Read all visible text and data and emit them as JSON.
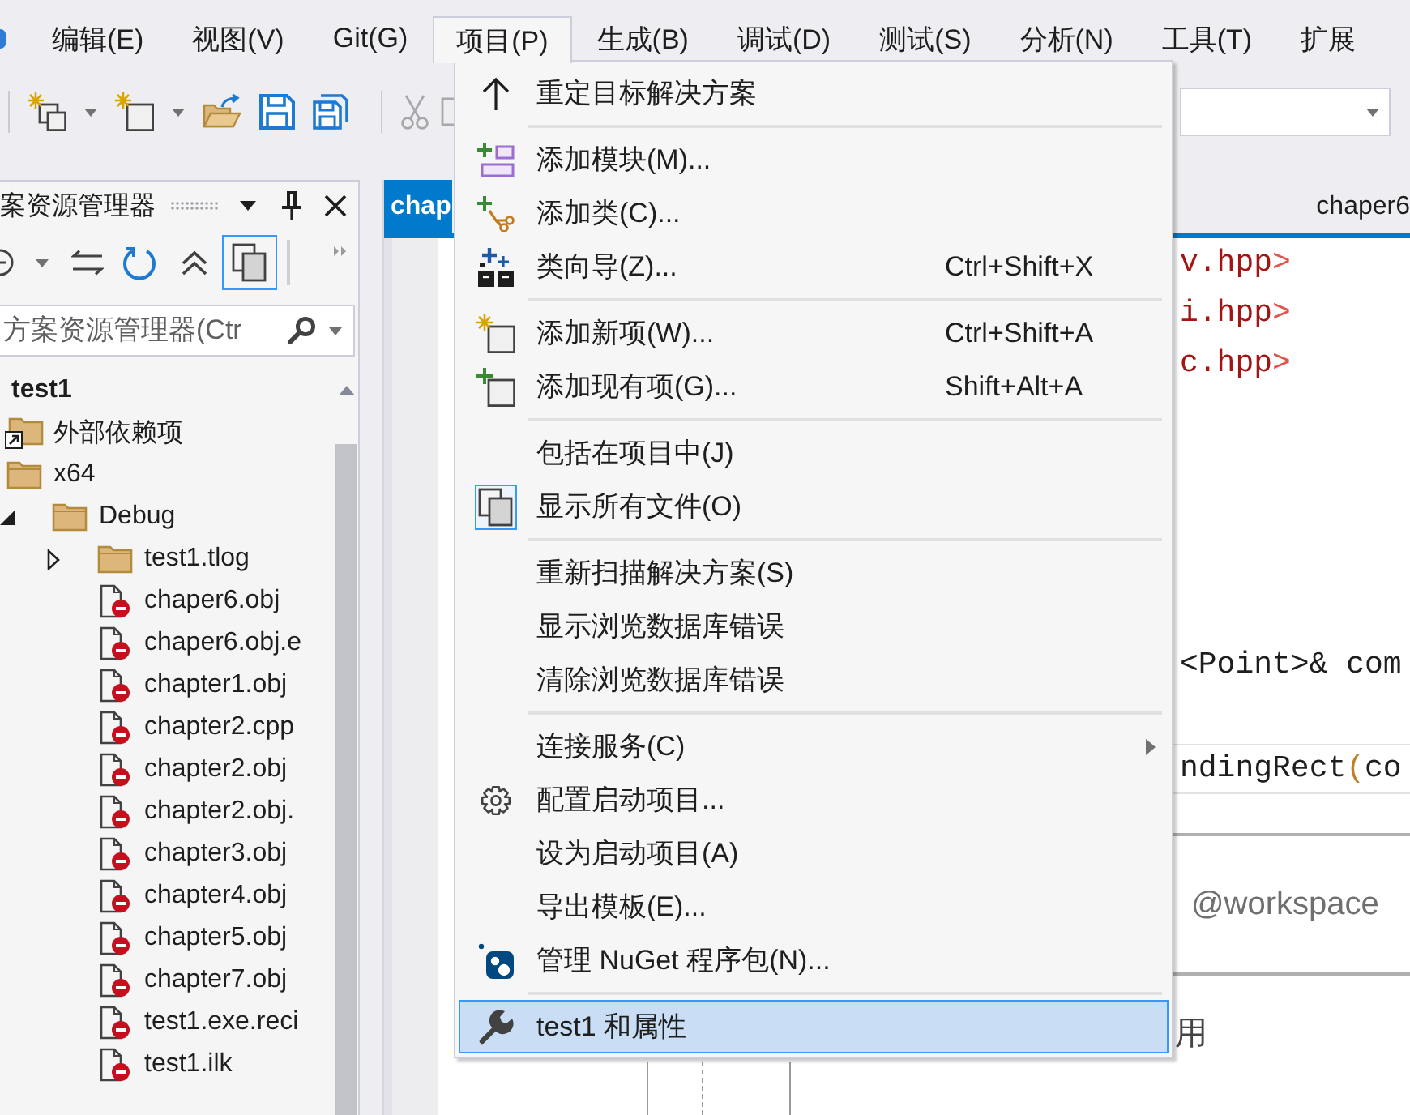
{
  "menubar": [
    {
      "label": "编辑(E)",
      "selected": false
    },
    {
      "label": "视图(V)",
      "selected": false
    },
    {
      "label": "Git(G)",
      "selected": false
    },
    {
      "label": "项目(P)",
      "selected": true
    },
    {
      "label": "生成(B)",
      "selected": false
    },
    {
      "label": "调试(D)",
      "selected": false
    },
    {
      "label": "测试(S)",
      "selected": false
    },
    {
      "label": "分析(N)",
      "selected": false
    },
    {
      "label": "工具(T)",
      "selected": false
    },
    {
      "label": "扩展",
      "selected": false
    }
  ],
  "project_menu": [
    {
      "kind": "item",
      "label": "重定目标解决方案",
      "checked": false,
      "submenu": false,
      "selected": false
    },
    {
      "kind": "separator"
    },
    {
      "kind": "item",
      "label": "添加模块(M)...",
      "checked": false,
      "submenu": false,
      "selected": false
    },
    {
      "kind": "item",
      "label": "添加类(C)...",
      "checked": false,
      "submenu": false,
      "selected": false
    },
    {
      "kind": "item",
      "label": "类向导(Z)...",
      "shortcut": "Ctrl+Shift+X",
      "checked": false,
      "submenu": false,
      "selected": false
    },
    {
      "kind": "separator"
    },
    {
      "kind": "item",
      "label": "添加新项(W)...",
      "shortcut": "Ctrl+Shift+A",
      "checked": false,
      "submenu": false,
      "selected": false
    },
    {
      "kind": "item",
      "label": "添加现有项(G)...",
      "shortcut": "Shift+Alt+A",
      "checked": false,
      "submenu": false,
      "selected": false
    },
    {
      "kind": "separator"
    },
    {
      "kind": "item",
      "label": "包括在项目中(J)",
      "checked": false,
      "submenu": false,
      "selected": false
    },
    {
      "kind": "item",
      "label": "显示所有文件(O)",
      "checked": true,
      "submenu": false,
      "selected": false
    },
    {
      "kind": "separator"
    },
    {
      "kind": "item",
      "label": "重新扫描解决方案(S)",
      "checked": false,
      "submenu": false,
      "selected": false
    },
    {
      "kind": "item",
      "label": "显示浏览数据库错误",
      "checked": false,
      "submenu": false,
      "selected": false
    },
    {
      "kind": "item",
      "label": "清除浏览数据库错误",
      "checked": false,
      "submenu": false,
      "selected": false
    },
    {
      "kind": "separator"
    },
    {
      "kind": "item",
      "label": "连接服务(C)",
      "checked": false,
      "submenu": true,
      "selected": false
    },
    {
      "kind": "item",
      "label": "配置启动项目...",
      "checked": false,
      "submenu": false,
      "selected": false
    },
    {
      "kind": "item",
      "label": "设为启动项目(A)",
      "checked": false,
      "submenu": false,
      "selected": false
    },
    {
      "kind": "item",
      "label": "导出模板(E)...",
      "checked": false,
      "submenu": false,
      "selected": false
    },
    {
      "kind": "item",
      "label": "管理 NuGet 程序包(N)...",
      "checked": false,
      "submenu": false,
      "selected": false
    },
    {
      "kind": "separator"
    },
    {
      "kind": "item",
      "label": "test1 和属性",
      "checked": false,
      "submenu": false,
      "selected": true
    }
  ],
  "toolbar": [
    {
      "disabled": false
    },
    {
      "disabled": false
    },
    {
      "disabled": false
    },
    {
      "disabled": false
    },
    {
      "disabled": false
    },
    {
      "disabled": true
    },
    {
      "disabled": true
    }
  ],
  "solution_explorer": {
    "title": "案资源管理器",
    "toolbar": [
      {
        "on": false
      },
      {
        "on": false
      },
      {
        "on": false
      },
      {
        "on": false
      },
      {
        "on": true
      }
    ],
    "search": {
      "placeholder": "方案资源管理器(Ctr"
    },
    "tree": [
      {
        "label": "test1",
        "kind": "project",
        "children": [
          {
            "label": "外部依赖项",
            "kind": "dependencies"
          },
          {
            "label": "x64",
            "kind": "folder",
            "children": [
              {
                "label": "Debug",
                "kind": "folder",
                "expanded": true,
                "children": [
                  {
                    "label": "test1.tlog",
                    "kind": "folder",
                    "expanded": false
                  },
                  {
                    "label": "chaper6.obj",
                    "kind": "file"
                  },
                  {
                    "label": "chaper6.obj.e",
                    "kind": "file"
                  },
                  {
                    "label": "chapter1.obj",
                    "kind": "file"
                  },
                  {
                    "label": "chapter2.cpp",
                    "kind": "file"
                  },
                  {
                    "label": "chapter2.obj",
                    "kind": "file"
                  },
                  {
                    "label": "chapter2.obj.",
                    "kind": "file"
                  },
                  {
                    "label": "chapter3.obj",
                    "kind": "file"
                  },
                  {
                    "label": "chapter4.obj",
                    "kind": "file"
                  },
                  {
                    "label": "chapter5.obj",
                    "kind": "file"
                  },
                  {
                    "label": "chapter7.obj",
                    "kind": "file"
                  },
                  {
                    "label": "test1.exe.reci",
                    "kind": "file"
                  },
                  {
                    "label": "test1.ilk",
                    "kind": "file"
                  }
                ]
              }
            ]
          }
        ]
      }
    ]
  },
  "editor": {
    "tabs": [
      {
        "label": "chap",
        "selected": true
      },
      {
        "label": "chaper6",
        "selected": false
      }
    ],
    "include_lines": [
      {
        "tokens": [
          {
            "text": "v.hpp",
            "kind": "string"
          },
          {
            "text": ">",
            "kind": "delimiter"
          }
        ]
      },
      {
        "tokens": [
          {
            "text": "i.hpp",
            "kind": "string"
          },
          {
            "text": ">",
            "kind": "delimiter"
          }
        ]
      },
      {
        "tokens": [
          {
            "text": "c.hpp",
            "kind": "string"
          },
          {
            "text": ">",
            "kind": "delimiter"
          }
        ]
      }
    ],
    "code_lines": [
      {
        "current": false,
        "tokens": [
          {
            "text": "<Point>& com",
            "kind": "plain"
          }
        ]
      },
      {
        "current": true,
        "tokens": [
          {
            "text": "ndingRect",
            "kind": "plain"
          },
          {
            "text": "(",
            "kind": "brace"
          },
          {
            "text": "co",
            "kind": "plain"
          }
        ]
      }
    ],
    "chat_input": {
      "placeholder": "@workspace"
    },
    "response": "用"
  }
}
